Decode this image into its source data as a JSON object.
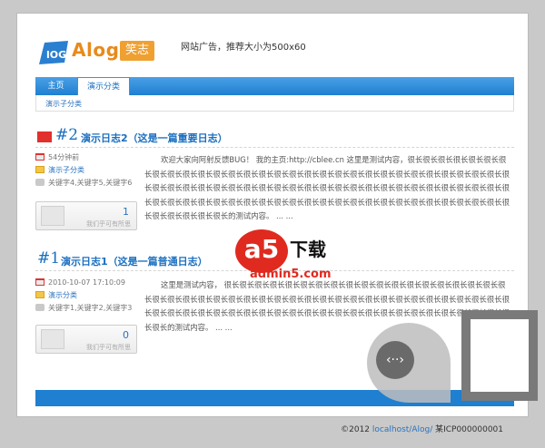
{
  "header": {
    "logo_text": "Alog",
    "logo_cn": "笑志",
    "ad_text": "网站广告，推荐大小为500x60"
  },
  "nav": {
    "items": [
      {
        "label": "主页"
      },
      {
        "label": "演示分类"
      }
    ],
    "sub_items": [
      {
        "label": "演示子分类"
      }
    ]
  },
  "posts": [
    {
      "number": "#2",
      "title": "演示日志2（这是一篇重要日志）",
      "time": "54分钟前",
      "category": "演示子分类",
      "tags": "关键字4,关键字5,关键字6",
      "votes": "1",
      "vote_text": "我们乎可有所思",
      "body": "欢迎大家向阿射反馈BUG！ 我的主页:http://cblee.cn   这里是测试内容，很长很长很长很长很长很长很长很长很长很长很长很长很长很长很长很长很长很长很长很长很长很长很长很长很长很长很长很长很长很长很长很长很长很长很长很长很长很长很长很长很长很长很长很长很长很长很长很长很长很长很长很长很长很长很长很长很长很长很长很长很长很长很长很长很长很长很长很长很长很长很长很长很长很长很长很长很长很长很长很长很长很长很长很长的测试内容。 ... ..."
    },
    {
      "number": "#1",
      "title": "演示日志1（这是一篇普通日志）",
      "time": "2010-10-07 17:10:09",
      "category": "演示分类",
      "tags": "关键字1,关键字2,关键字3",
      "votes": "0",
      "vote_text": "我们乎可有所思",
      "body": "这里是测试内容， 很长很长很长很长很长很长很长很长很长很长很长很长很长很长很长很长很长很长很长很长很长很长很长很长很长很长很长很长很长很长很长很长很长很长很长很长很长很长很长很长很长很长很长很长很长很长很长很长很长很长很长很长很长很长很长很长很长很长很长很长很长很长很长很长很长很长很长很长的测试内容。 ... ..."
    }
  ],
  "watermark": {
    "logo": "a5",
    "text": "下载",
    "url": "admin5.com"
  },
  "footer": {
    "copyright": "©2012 ",
    "link": "localhost/Alog/",
    "icp": " 某ICP000000001"
  },
  "colors": {
    "accent": "#1f7fd0",
    "link": "#2a72c0",
    "brand": "#e88a1a"
  }
}
